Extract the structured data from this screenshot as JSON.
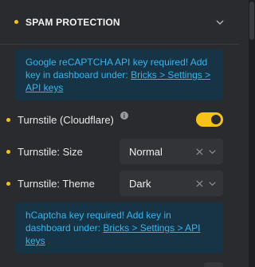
{
  "section": {
    "title": "SPAM PROTECTION"
  },
  "notice_recaptcha": {
    "text": "Google reCAPTCHA API key required! Add key in dashboard under: ",
    "link": "Bricks > Settings > API keys"
  },
  "turnstile": {
    "label": "Turnstile (Cloudflare)",
    "enabled": true
  },
  "turnstile_size": {
    "label": "Turnstile: Size",
    "value": "Normal"
  },
  "turnstile_theme": {
    "label": "Turnstile: Theme",
    "value": "Dark"
  },
  "notice_hcaptcha": {
    "text": "hCaptcha key required! Add key in dashboard under: ",
    "link": "Bricks > Settings > API keys"
  },
  "icons": {
    "section_toggle": "chevron-down-icon",
    "info": "info-icon",
    "clear": "close-icon",
    "dropdown": "chevron-down-icon"
  },
  "colors": {
    "accent": "#f5c21a",
    "notice_bg": "#163445",
    "notice_text": "#36b4ee",
    "panel_bg": "#2a2b2f"
  }
}
